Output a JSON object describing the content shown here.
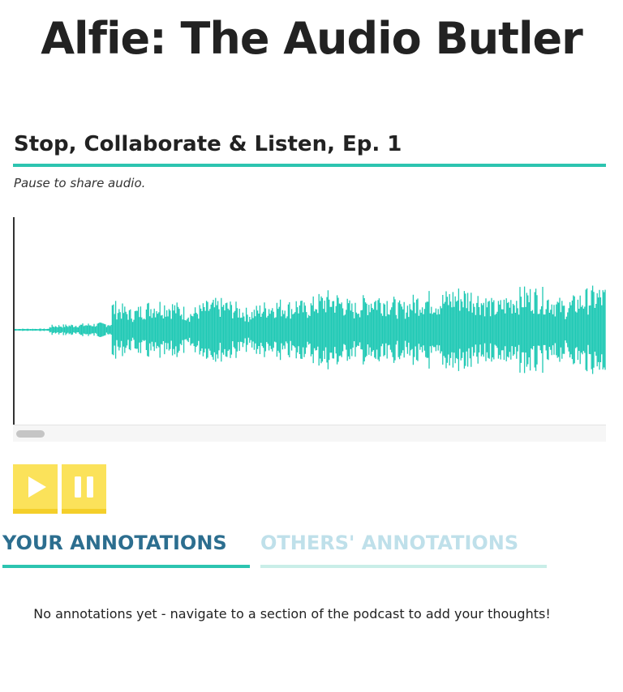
{
  "app": {
    "title": "Alfie: The Audio Butler"
  },
  "episode": {
    "title": "Stop, Collaborate & Listen, Ep. 1",
    "hint": "Pause to share audio."
  },
  "waveform": {
    "color": "#1fc9b4",
    "cursor_color": "#333333",
    "scroll_position": 0
  },
  "controls": {
    "play_icon": "play-icon",
    "pause_icon": "pause-icon",
    "button_color": "#fbe25a"
  },
  "tabs": [
    {
      "label": "YOUR ANNOTATIONS",
      "active": true
    },
    {
      "label": "OTHERS' ANNOTATIONS",
      "active": false
    }
  ],
  "annotations": {
    "items": [],
    "empty_message": "No annotations yet - navigate to a section of the podcast to add your thoughts!"
  },
  "colors": {
    "accent": "#2cc4b0",
    "active_tab_text": "#2c6e8f",
    "inactive_tab_text": "#bfe0ea"
  }
}
